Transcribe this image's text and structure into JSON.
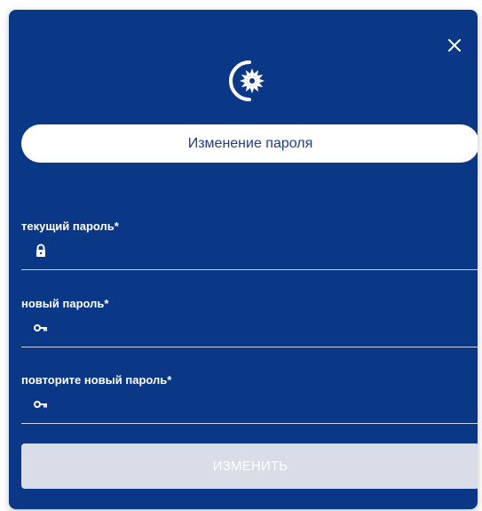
{
  "dialog": {
    "title": "Изменение пароля",
    "close_icon": "close-icon",
    "logo_icon": "company-logo"
  },
  "fields": {
    "current_password": {
      "label": "текущий пароль*",
      "icon": "lock-icon",
      "value": ""
    },
    "new_password": {
      "label": "новый пароль*",
      "icon": "key-icon",
      "value": ""
    },
    "repeat_password": {
      "label": "повторите новый пароль*",
      "icon": "key-icon",
      "value": ""
    }
  },
  "submit": {
    "label": "ИЗМЕНИТЬ",
    "enabled": false
  },
  "colors": {
    "modal_background": "#0b3886",
    "pill_background": "#ffffff",
    "title_text": "#1d3f83",
    "button_disabled": "#d9dde7",
    "field_underline": "#c8d2e6"
  }
}
